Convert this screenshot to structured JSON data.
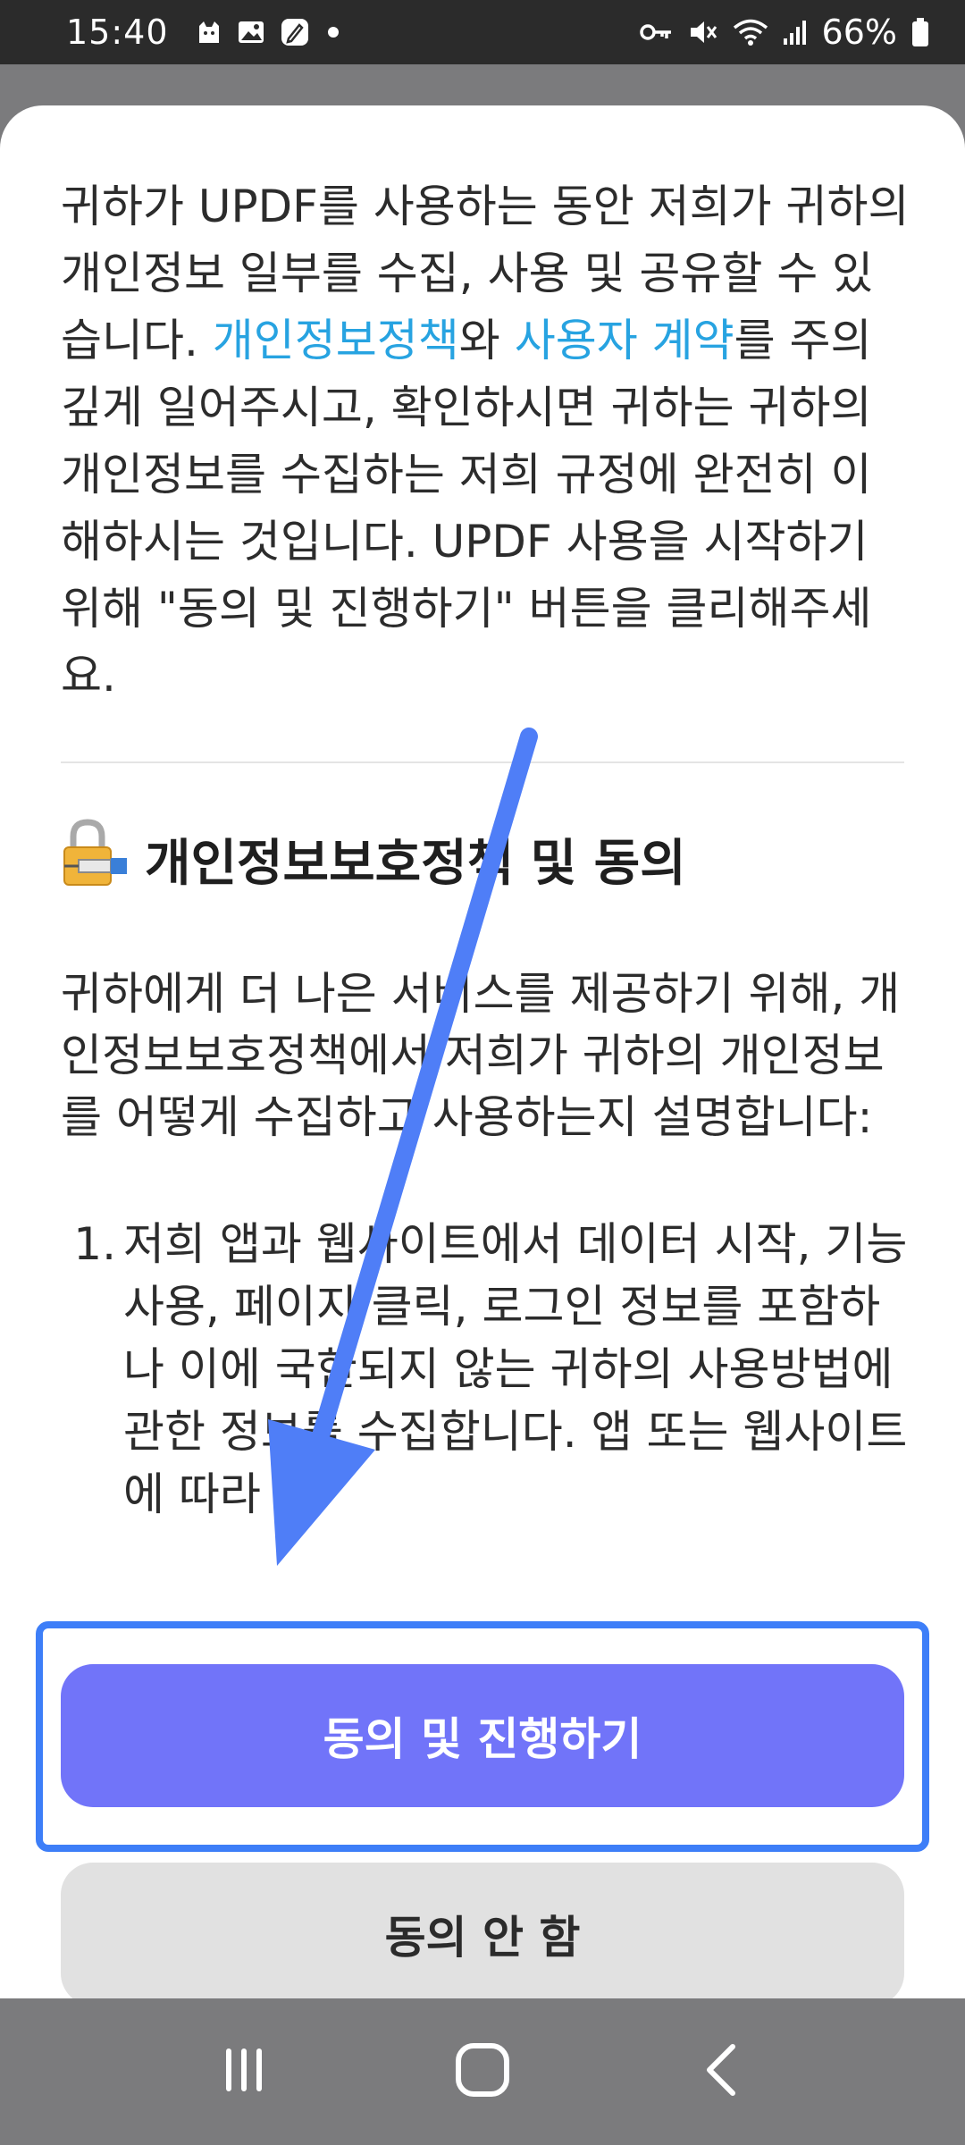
{
  "status_bar": {
    "time": "15:40",
    "battery": "66%",
    "left_icons": [
      "cat-app-icon",
      "gallery-icon",
      "notes-icon",
      "dot-icon"
    ],
    "right_icons": [
      "key-icon",
      "mute-icon",
      "wifi-icon",
      "signal-icon",
      "battery-icon"
    ]
  },
  "dialog": {
    "intro_pre": "귀하가 UPDF를 사용하는 동안 저희가 귀하의 개인정보 일부를 수집, 사용 및 공유할 수 있습니다. ",
    "privacy_link": "개인정보정책",
    "intro_mid": "와 ",
    "terms_link": "사용자 계약",
    "intro_post": "를 주의깊게 일어주시고, 확인하시면 귀하는 귀하의 개인정보를 수집하는 저희 규정에 완전히 이해하시는 것입니다. UPDF 사용을 시작하기 위해 \"동의 및 진행하기\" 버튼을 클리해주세요.",
    "section_title": "개인정보보호정책 및 동의",
    "section_body": "귀하에게 더 나은 서비스를 제공하기 위해, 개인정보보호정책에서 저희가 귀하의 개인정보를 어떻게 수집하고 사용하는지 설명합니다:",
    "list": [
      {
        "num": "1.",
        "text": "저희 앱과 웹사이트에서 데이터 시작, 기능 사용, 페이지 클릭, 로그인 정보를 포함하나 이에 국한되지 않는 귀하의 사용방법에 관한 정보를 수집합니다. 앱 또는 웹사이트에 따라"
      }
    ],
    "agree_button": "동의 및 진행하기",
    "decline_button": "동의 안 함"
  },
  "colors": {
    "link": "#27a3e1",
    "agree_button": "#7174f9",
    "decline_button": "#e1e1e1",
    "highlight": "#3d7ef8",
    "arrow": "#4f7ef7"
  },
  "nav_bar": {
    "icons": [
      "recents-icon",
      "home-icon",
      "back-icon"
    ]
  }
}
